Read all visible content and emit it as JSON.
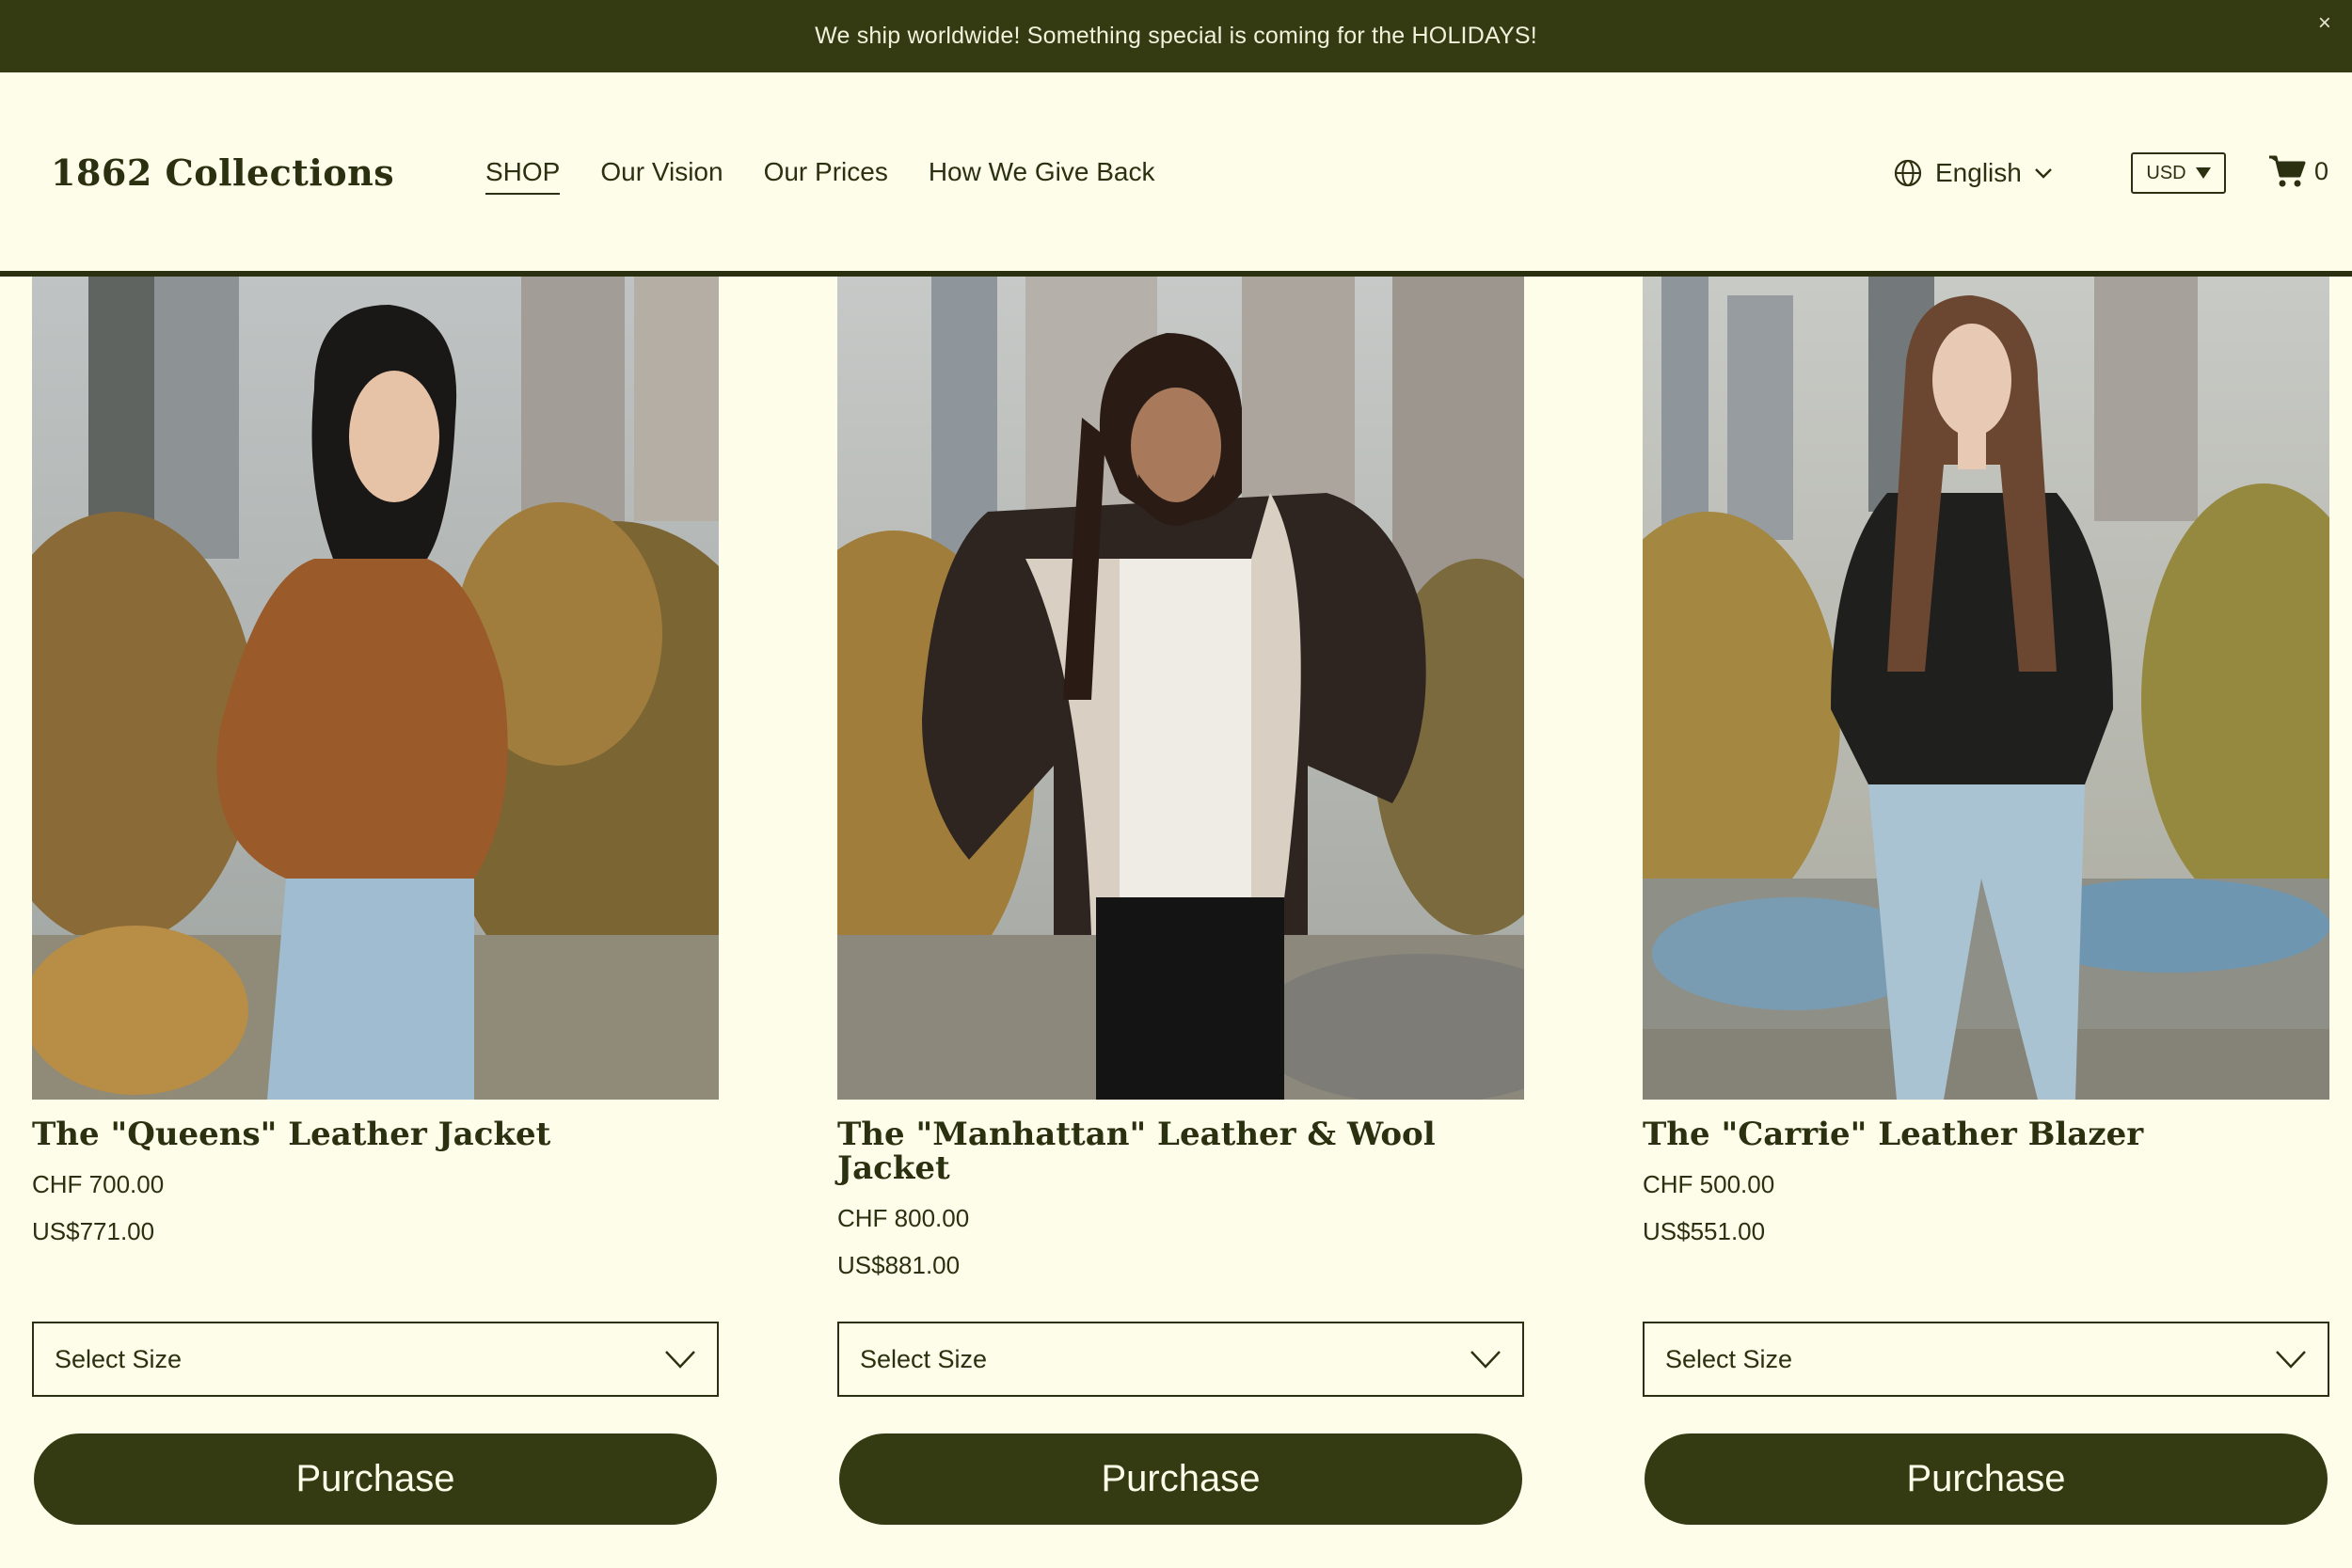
{
  "announcement": {
    "text": "We ship worldwide! Something special is coming for the HOLIDAYS!",
    "close": "×"
  },
  "brand": {
    "name": "1862 Collections"
  },
  "nav": {
    "items": [
      {
        "label": "SHOP",
        "active": true
      },
      {
        "label": "Our Vision"
      },
      {
        "label": "Our Prices"
      },
      {
        "label": "How We Give Back"
      }
    ]
  },
  "language": {
    "label": "English",
    "icon": "globe-icon"
  },
  "currency": {
    "label": "USD"
  },
  "cart": {
    "count": "0",
    "icon": "cart-icon"
  },
  "colors": {
    "accent": "#343a12",
    "background": "#fdfde9",
    "text": "#2b3010"
  },
  "products": [
    {
      "title": "The \"Queens\" Leather Jacket",
      "price_chf": "CHF 700.00",
      "price_usd": "US$771.00",
      "size_placeholder": "Select Size",
      "button": "Purchase"
    },
    {
      "title": "The \"Manhattan\" Leather & Wool Jacket",
      "price_chf": "CHF 800.00",
      "price_usd": "US$881.00",
      "size_placeholder": "Select Size",
      "button": "Purchase"
    },
    {
      "title": "The \"Carrie\" Leather Blazer",
      "price_chf": "CHF 500.00",
      "price_usd": "US$551.00",
      "size_placeholder": "Select Size",
      "button": "Purchase"
    }
  ]
}
